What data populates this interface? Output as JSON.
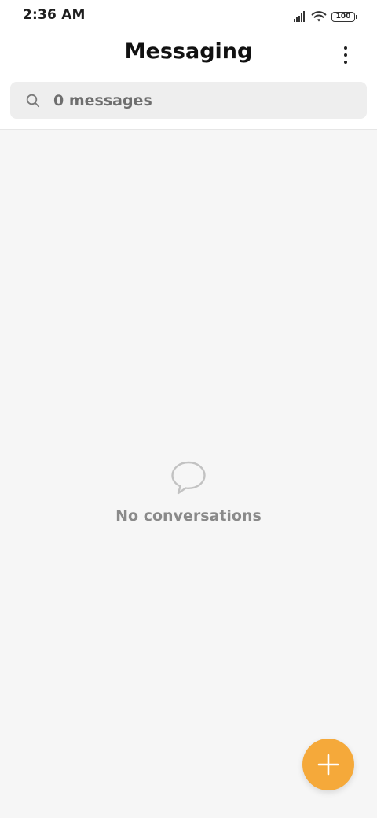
{
  "status_bar": {
    "time": "2:36 AM",
    "battery_level": "100",
    "icons": [
      "signal-icon",
      "wifi-icon",
      "battery-icon"
    ]
  },
  "header": {
    "title": "Messaging",
    "menu_icon": "more-vertical-icon"
  },
  "search": {
    "icon": "search-icon",
    "placeholder": "0 messages"
  },
  "empty_state": {
    "icon": "chat-bubble-icon",
    "text": "No conversations"
  },
  "fab": {
    "icon": "plus-icon",
    "color": "#f5a93a"
  },
  "colors": {
    "accent": "#f5a93a",
    "background": "#f6f6f6",
    "search_bg": "#eeeeee"
  }
}
